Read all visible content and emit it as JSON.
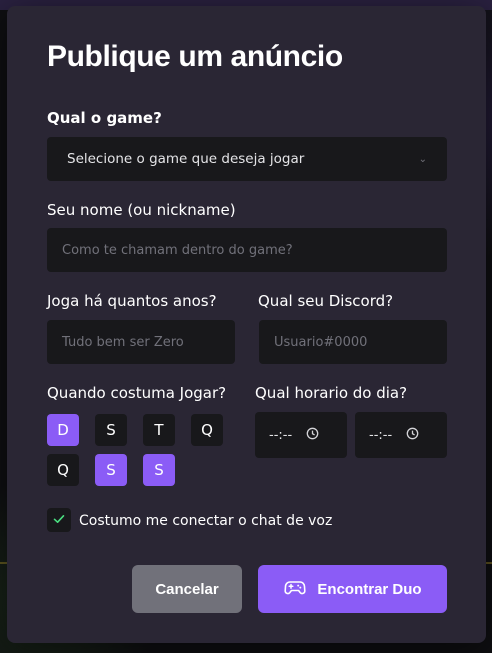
{
  "modal": {
    "title": "Publique um anúncio",
    "game_label": "Qual o game?",
    "game_select_value": "Selecione o game que deseja jogar",
    "name_label": "Seu nome (ou nickname)",
    "name_placeholder": "Como te chamam dentro do game?",
    "years_label": "Joga há quantos anos?",
    "years_placeholder": "Tudo bem ser Zero",
    "discord_label": "Qual seu Discord?",
    "discord_placeholder": "Usuario#0000",
    "days_label": "Quando costuma Jogar?",
    "days": [
      {
        "label": "D",
        "selected": true
      },
      {
        "label": "S",
        "selected": false
      },
      {
        "label": "T",
        "selected": false
      },
      {
        "label": "Q",
        "selected": false
      },
      {
        "label": "Q",
        "selected": false
      },
      {
        "label": "S",
        "selected": true
      },
      {
        "label": "S",
        "selected": true
      }
    ],
    "hours_label": "Qual horario do dia?",
    "hour_start_value": "--:--",
    "hour_end_value": "--:--",
    "voice_checked": true,
    "voice_label": "Costumo me conectar o chat de voz",
    "cancel_label": "Cancelar",
    "submit_label": "Encontrar Duo"
  },
  "colors": {
    "accent": "#8b5cf6",
    "modal_bg": "#2a2634",
    "input_bg": "#18181b",
    "cancel_bg": "#71717a",
    "check": "#4ade80"
  },
  "icons": {
    "game_select": "chevron-down-icon",
    "time": "clock-icon",
    "checkbox": "check-icon",
    "submit": "game-controller-icon"
  }
}
